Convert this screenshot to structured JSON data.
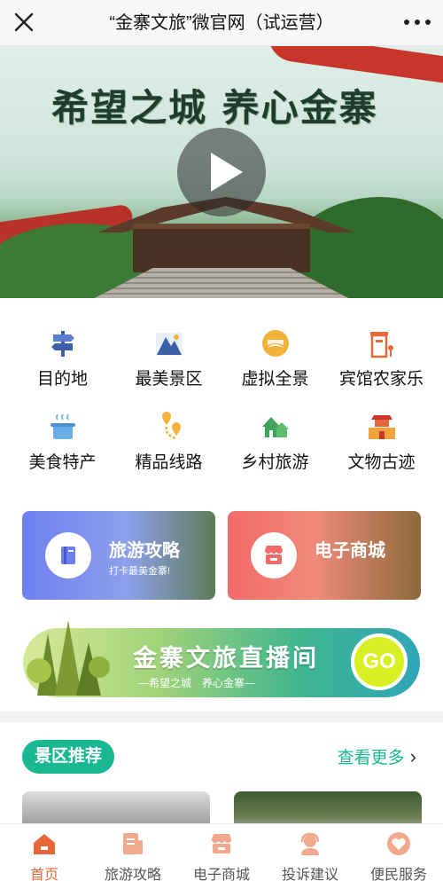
{
  "topbar": {
    "title": "“金寨文旅”微官网（试运营）"
  },
  "hero": {
    "slogan": "希望之城 养心金寨"
  },
  "categories": [
    {
      "label": "目的地",
      "icon": "signpost-icon"
    },
    {
      "label": "最美景区",
      "icon": "mountain-icon"
    },
    {
      "label": "虚拟全景",
      "icon": "panorama-icon"
    },
    {
      "label": "宾馆农家乐",
      "icon": "hotel-icon"
    },
    {
      "label": "美食特产",
      "icon": "food-pot-icon"
    },
    {
      "label": "精品线路",
      "icon": "route-icon"
    },
    {
      "label": "乡村旅游",
      "icon": "village-icon"
    },
    {
      "label": "文物古迹",
      "icon": "heritage-icon"
    }
  ],
  "cards": {
    "guide": {
      "title": "旅游攻略",
      "subtitle": "打卡最美金寨!"
    },
    "shop": {
      "title": "电子商城"
    }
  },
  "live": {
    "title": "金寨文旅直播间",
    "subtitle": "—希望之城　养心金寨—",
    "go": "GO"
  },
  "section": {
    "tag": "景区推荐",
    "more": "查看更多"
  },
  "tabbar": [
    {
      "label": "首页",
      "icon": "home-icon",
      "active": true
    },
    {
      "label": "旅游攻略",
      "icon": "guide-doc-icon",
      "active": false
    },
    {
      "label": "电子商城",
      "icon": "shop-icon",
      "active": false
    },
    {
      "label": "投诉建议",
      "icon": "support-agent-icon",
      "active": false
    },
    {
      "label": "便民服务",
      "icon": "heart-service-icon",
      "active": false
    }
  ],
  "colors": {
    "accent": "#19b892",
    "tab_active": "#e8673a",
    "tab_inactive": "#f0a98c"
  }
}
